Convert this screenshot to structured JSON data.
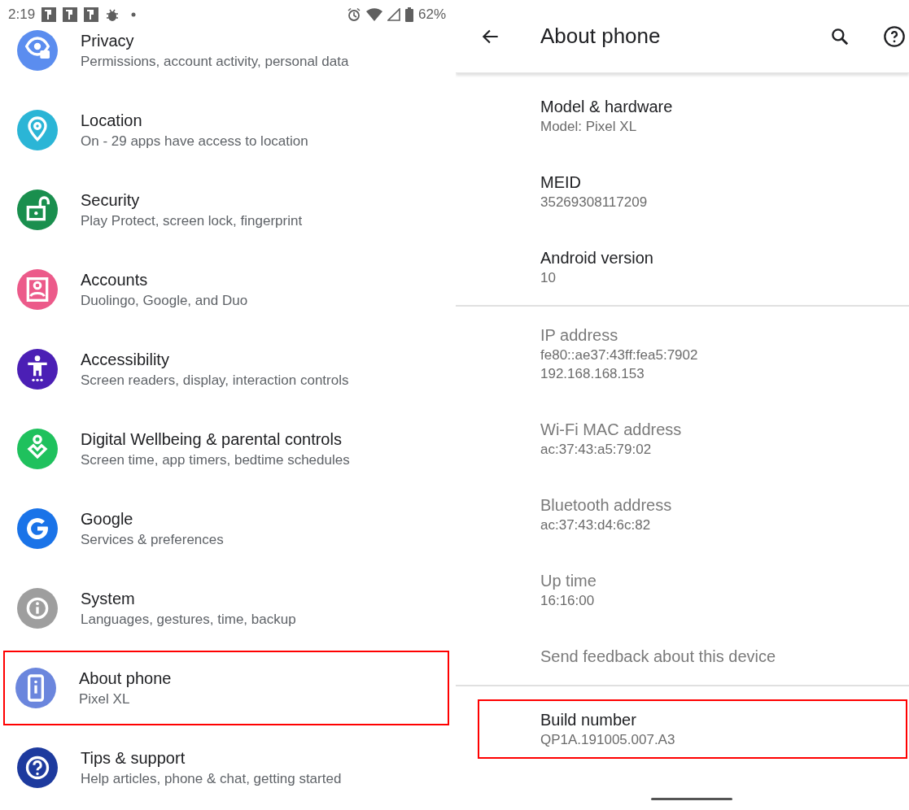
{
  "status_bar": {
    "time": "2:19",
    "battery": "62%"
  },
  "settings": {
    "items": [
      {
        "title": "Privacy",
        "subtitle": "Permissions, account activity, personal data",
        "color": "#5b8def",
        "highlighted": false
      },
      {
        "title": "Location",
        "subtitle": "On - 29 apps have access to location",
        "color": "#2bb5d6",
        "highlighted": false
      },
      {
        "title": "Security",
        "subtitle": "Play Protect, screen lock, fingerprint",
        "color": "#1a8f4e",
        "highlighted": false
      },
      {
        "title": "Accounts",
        "subtitle": "Duolingo, Google, and Duo",
        "color": "#ec5a8a",
        "highlighted": false
      },
      {
        "title": "Accessibility",
        "subtitle": "Screen readers, display, interaction controls",
        "color": "#4b1fb5",
        "highlighted": false
      },
      {
        "title": "Digital Wellbeing & parental controls",
        "subtitle": "Screen time, app timers, bedtime schedules",
        "color": "#1fc15d",
        "highlighted": false
      },
      {
        "title": "Google",
        "subtitle": "Services & preferences",
        "color": "#1a73e8",
        "highlighted": false
      },
      {
        "title": "System",
        "subtitle": "Languages, gestures, time, backup",
        "color": "#9e9e9e",
        "highlighted": false
      },
      {
        "title": "About phone",
        "subtitle": "Pixel XL",
        "color": "#6b86dd",
        "highlighted": true
      },
      {
        "title": "Tips & support",
        "subtitle": "Help articles, phone & chat, getting started",
        "color": "#1d3a9e",
        "highlighted": false
      }
    ]
  },
  "about": {
    "title": "About phone",
    "sections": [
      {
        "items": [
          {
            "title": "Model & hardware",
            "lines": [
              "Model: Pixel XL"
            ],
            "disabled": false,
            "highlighted": false
          },
          {
            "title": "MEID",
            "lines": [
              "35269308117209"
            ],
            "disabled": false,
            "highlighted": false
          },
          {
            "title": "Android version",
            "lines": [
              "10"
            ],
            "disabled": false,
            "highlighted": false
          }
        ]
      },
      {
        "items": [
          {
            "title": "IP address",
            "lines": [
              "fe80::ae37:43ff:fea5:7902",
              "192.168.168.153"
            ],
            "disabled": true,
            "highlighted": false
          },
          {
            "title": "Wi-Fi MAC address",
            "lines": [
              "ac:37:43:a5:79:02"
            ],
            "disabled": true,
            "highlighted": false
          },
          {
            "title": "Bluetooth address",
            "lines": [
              "ac:37:43:d4:6c:82"
            ],
            "disabled": true,
            "highlighted": false
          },
          {
            "title": "Up time",
            "lines": [
              "16:16:00"
            ],
            "disabled": true,
            "highlighted": false
          },
          {
            "title": "Send feedback about this device",
            "disabled": true,
            "highlighted": false
          }
        ]
      },
      {
        "items": [
          {
            "title": "Build number",
            "lines": [
              "QP1A.191005.007.A3"
            ],
            "disabled": false,
            "highlighted": true
          }
        ]
      }
    ]
  }
}
